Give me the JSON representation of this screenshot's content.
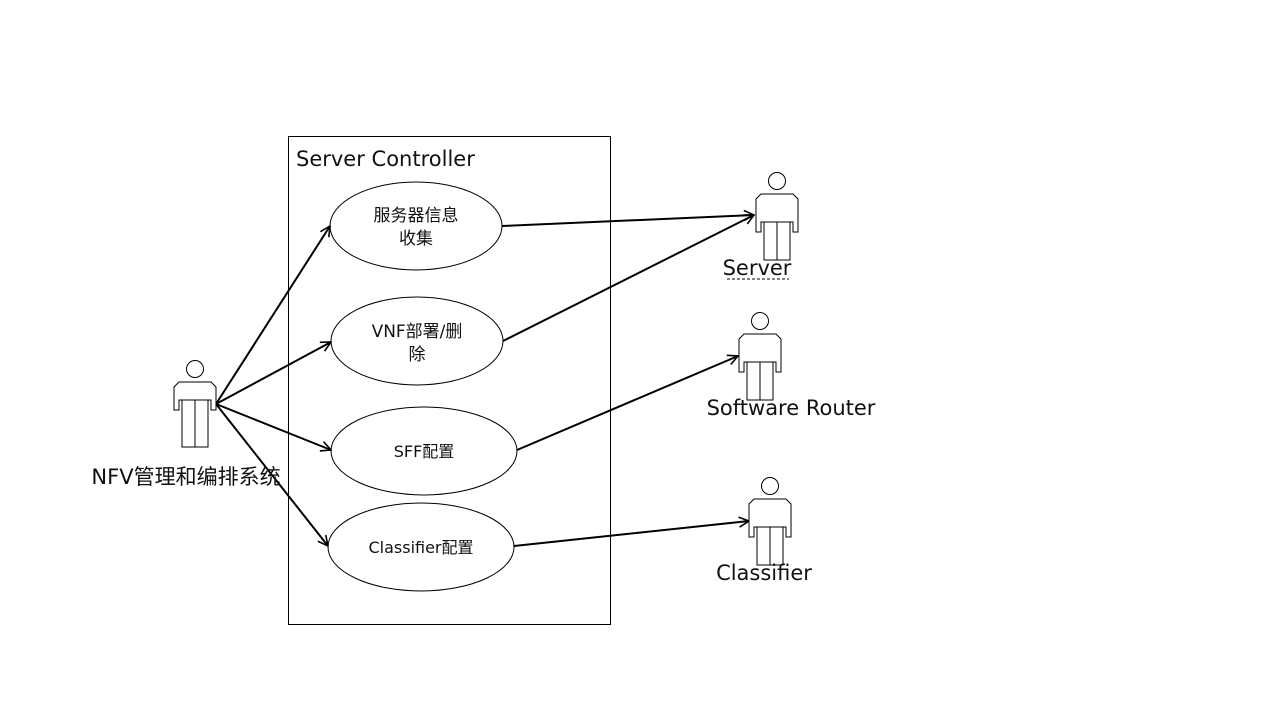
{
  "system": {
    "title": "Server Controller"
  },
  "use_cases": {
    "server_info": {
      "line1": "服务器信息",
      "line2": "收集"
    },
    "vnf_deploy": {
      "line1": "VNF部署/删",
      "line2": "除"
    },
    "sff_config": {
      "label": "SFF配置"
    },
    "classifier_config": {
      "label": "Classifier配置"
    }
  },
  "actors": {
    "nfv": {
      "label": "NFV管理和编排系统"
    },
    "server": {
      "label": "Server"
    },
    "software_router": {
      "label": "Software Router"
    },
    "classifier": {
      "label": "Classifier"
    }
  }
}
